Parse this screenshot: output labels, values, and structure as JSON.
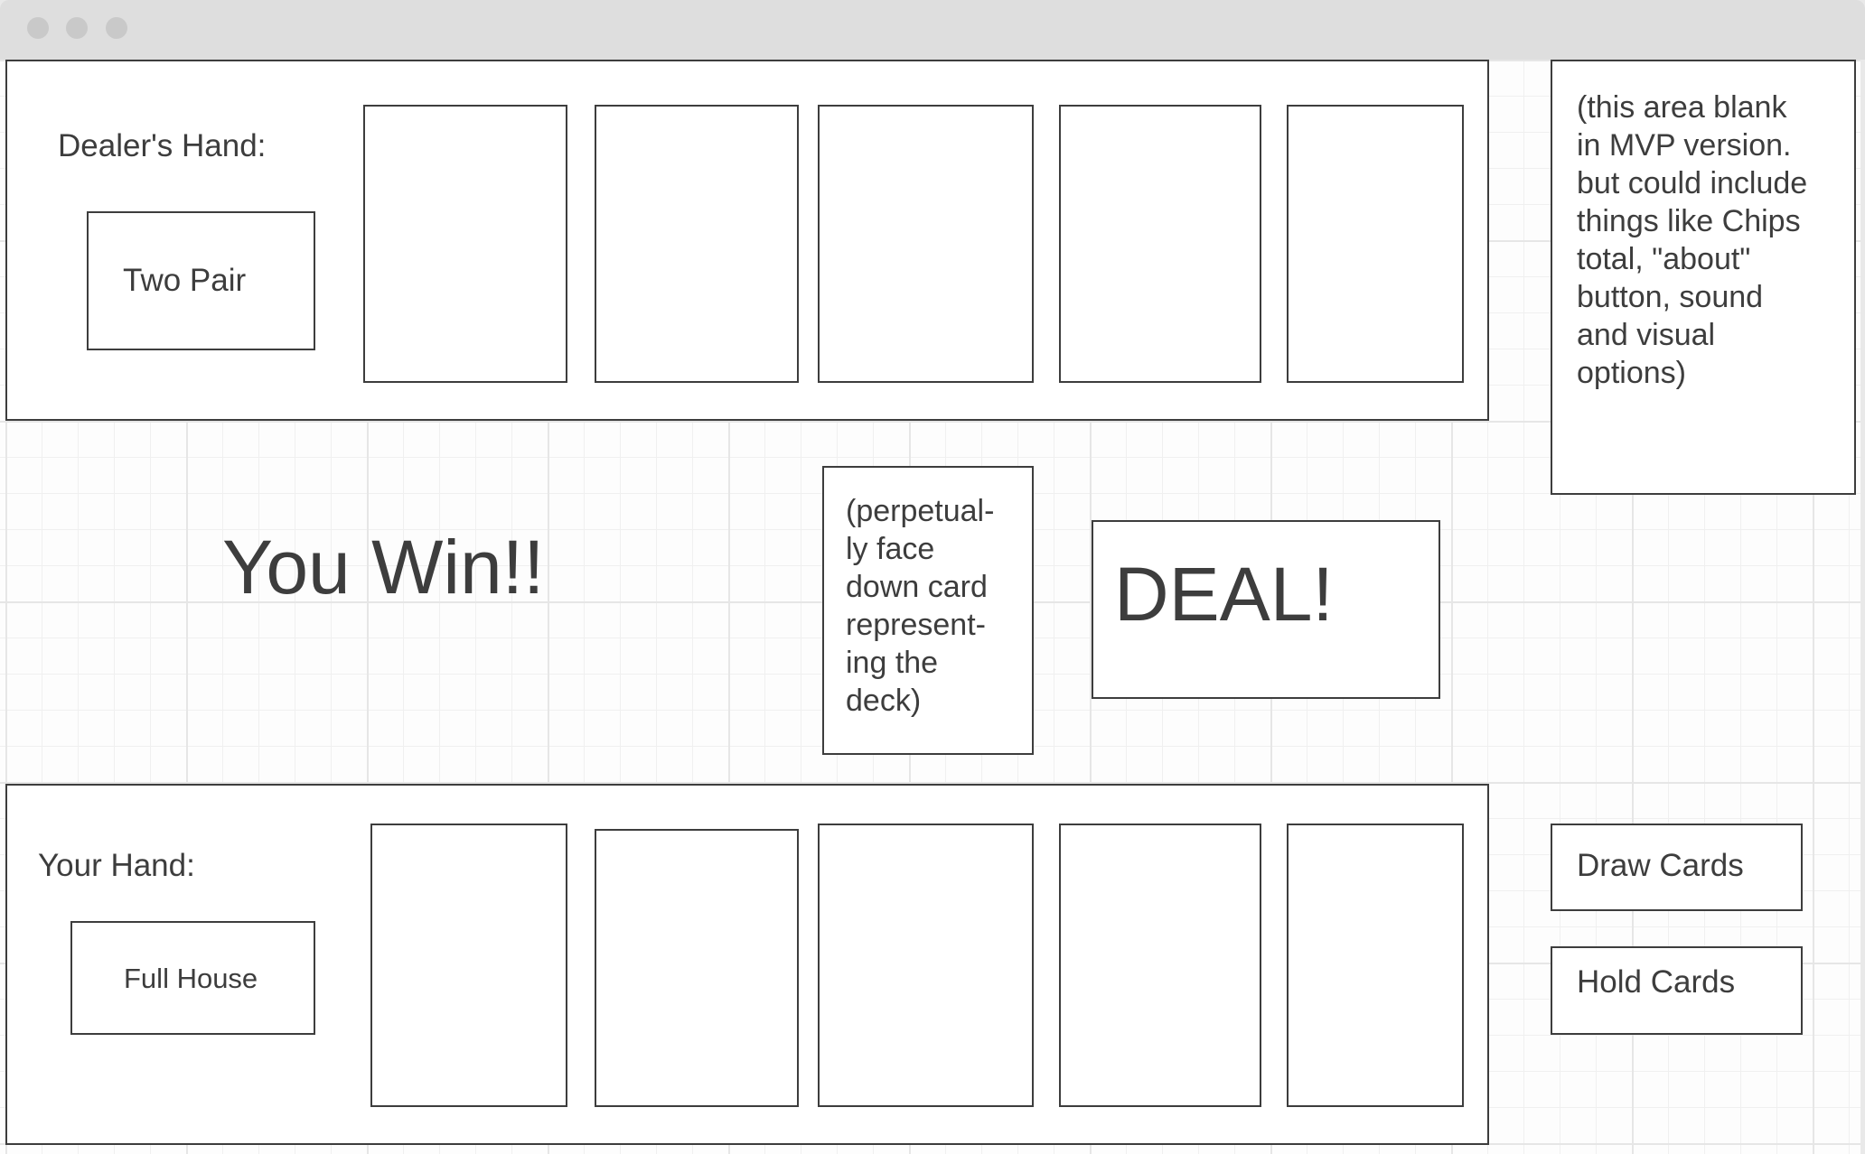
{
  "window": {
    "controls": [
      "close",
      "minimize",
      "maximize"
    ]
  },
  "dealer": {
    "label": "Dealer's Hand:",
    "hand_rank": "Two Pair",
    "card_count": 5
  },
  "player": {
    "label": "Your Hand:",
    "hand_rank": "Full House",
    "card_count": 5
  },
  "result": {
    "message": "You Win!!"
  },
  "deck": {
    "note": "(perpetual-\nly face\ndown card\nrepresent-\ning the\ndeck)"
  },
  "deal_button": {
    "label": "DEAL!"
  },
  "side_panel": {
    "note": "(this area blank\nin MVP version.\nbut could include\nthings like Chips\ntotal, \"about\"\nbutton, sound\nand visual\noptions)"
  },
  "actions": {
    "draw_label": "Draw Cards",
    "hold_label": "Hold Cards"
  },
  "colors": {
    "stroke": "#3d3d3d",
    "grid": "#e6e6e6",
    "titlebar": "#dedede"
  }
}
